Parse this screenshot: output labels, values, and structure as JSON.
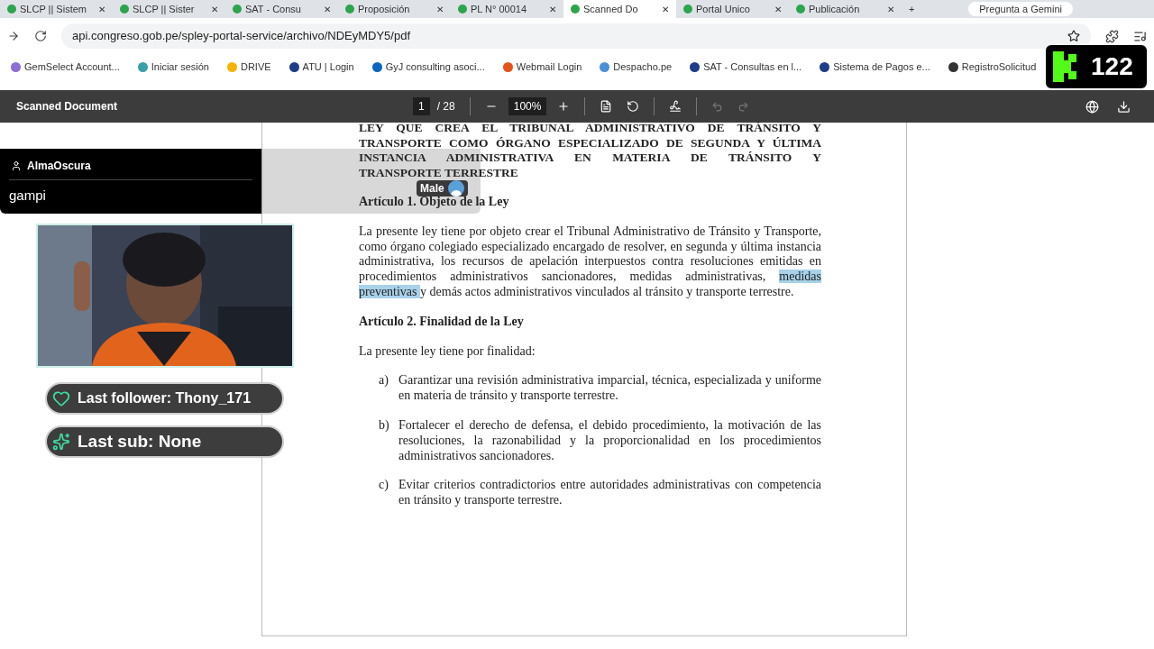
{
  "browser": {
    "tabs": [
      {
        "title": "SLCP || Sistem",
        "close": "✕",
        "selected": false
      },
      {
        "title": "SLCP || Sister",
        "close": "✕",
        "selected": false
      },
      {
        "title": "SAT - Consu",
        "close": "✕",
        "selected": false
      },
      {
        "title": "Proposición",
        "close": "✕",
        "selected": false
      },
      {
        "title": "PL N° 00014",
        "close": "✕",
        "selected": false
      },
      {
        "title": "Scanned Do",
        "close": "✕",
        "selected": true
      },
      {
        "title": "Portal Unico",
        "close": "✕",
        "selected": false
      },
      {
        "title": "Publicación",
        "close": "✕",
        "selected": false
      }
    ],
    "new_tab": "+",
    "gemini": "Pregunta a Gemini",
    "url": "api.congreso.gob.pe/spley-portal-service/archivo/NDEyMDY5/pdf",
    "bookmarks": [
      {
        "label": "GemSelect Account...",
        "color": "#8a6dd6"
      },
      {
        "label": "Iniciar sesión",
        "color": "#3aa0a8"
      },
      {
        "label": "DRIVE",
        "color": "#f4b400"
      },
      {
        "label": "ATU | Login",
        "color": "#1f3c88"
      },
      {
        "label": "GyJ consulting asoci...",
        "color": "#0a66c2"
      },
      {
        "label": "Webmail Login",
        "color": "#e8501a"
      },
      {
        "label": "Despacho.pe",
        "color": "#4a90d9"
      },
      {
        "label": "SAT - Consultas en l...",
        "color": "#1f3c88"
      },
      {
        "label": "Sistema de Pagos e...",
        "color": "#1f3c88"
      },
      {
        "label": "RegistroSolicitud",
        "color": "#333333"
      }
    ]
  },
  "pdf_toolbar": {
    "title": "Scanned Document",
    "page": "1",
    "page_count": "/ 28",
    "zoom": "100%"
  },
  "document": {
    "heading_lines": [
      "LEY QUE CREA EL TRIBUNAL ADMINISTRATIVO DE TRÁNSITO Y",
      "TRANSPORTE COMO ÓRGANO ESPECIALIZADO DE SEGUNDA Y ÚLTIMA",
      "INSTANCIA ADMINISTRATIVA EN MATERIA DE TRÁNSITO Y",
      "TRANSPORTE TERRESTRE"
    ],
    "article1_title": "Artículo 1. Objeto de la Ley",
    "article1_segments": [
      {
        "text": "La presente ley tiene por objeto crear el Tribunal Administrativo de Tránsito y Transporte, como órgano colegiado especializado encargado de resolver, en segunda y última instancia administrativa, los recursos de apelación interpuestos contra resoluciones emitidas en procedimientos administrativos sancionadores, medidas administrativas, ",
        "highlighted": false
      },
      {
        "text": "medidas preventivas ",
        "highlighted": true
      },
      {
        "text": "y demás actos administrativos vinculados al tránsito y transporte terrestre.",
        "highlighted": false
      }
    ],
    "article2_title": "Artículo 2. Finalidad de la Ley",
    "article2_intro": "La presente ley tiene por finalidad:",
    "items": [
      {
        "marker": "a)",
        "text": "Garantizar una revisión administrativa imparcial, técnica, especializada y uniforme en materia de tránsito y transporte terrestre."
      },
      {
        "marker": "b)",
        "text": "Fortalecer el derecho de defensa, el debido procedimiento, la motivación de las resoluciones, la razonabilidad y la proporcionalidad en los procedimientos administrativos sancionadores."
      },
      {
        "marker": "c)",
        "text": "Evitar criterios contradictorios entre autoridades administrativas con competencia en tránsito y transporte terrestre."
      }
    ]
  },
  "stream_overlay": {
    "chat_user": "AlmaOscura",
    "chat_message": "gampi",
    "voice": "Male",
    "viewer_count": "122",
    "widgets": [
      {
        "kind": "follower",
        "text": "Last follower: Thony_171"
      },
      {
        "kind": "sub",
        "text": "Last sub: None"
      }
    ]
  }
}
